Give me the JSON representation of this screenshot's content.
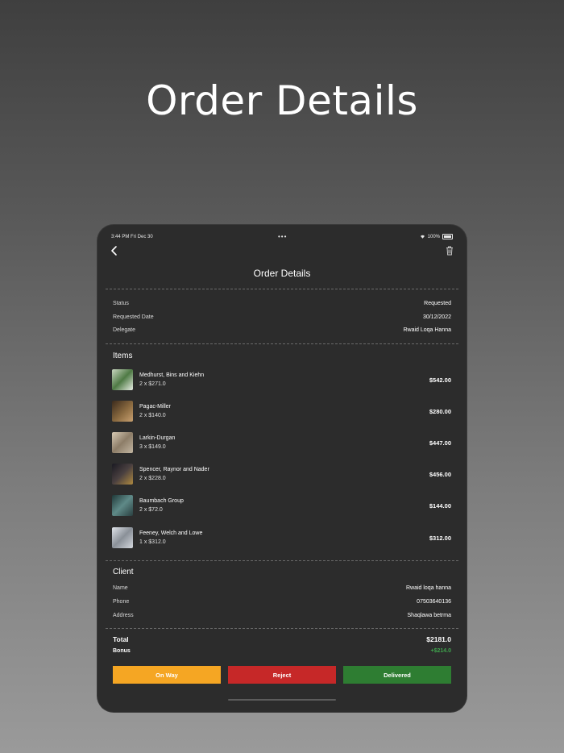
{
  "hero": {
    "title": "Order Details"
  },
  "status_bar": {
    "time": "3:44 PM  Fri Dec 30",
    "dots": "•••",
    "battery": "100%"
  },
  "header": {
    "title": "Order Details",
    "back_icon": "chevron-left-icon",
    "trash_icon": "trash-icon"
  },
  "details": [
    {
      "label": "Status",
      "value": "Requested"
    },
    {
      "label": "Requested Date",
      "value": "30/12/2022"
    },
    {
      "label": "Delegate",
      "value": "Rwaid Loqa Hanna"
    }
  ],
  "items_section": {
    "title": "Items",
    "items": [
      {
        "name": "Medhurst, Bins and Kiehn",
        "qty": "2  x  $271.0",
        "total": "$542.00",
        "thumb_color": "#6f8f5a"
      },
      {
        "name": "Pagac-Miller",
        "qty": "2  x  $140.0",
        "total": "$280.00",
        "thumb_color": "#7a5a3a"
      },
      {
        "name": "Larkin-Durgan",
        "qty": "3  x  $149.0",
        "total": "$447.00",
        "thumb_color": "#a89880"
      },
      {
        "name": "Spencer, Raynor and Nader",
        "qty": "2  x  $228.0",
        "total": "$456.00",
        "thumb_color": "#2a2a2e"
      },
      {
        "name": "Baumbach Group",
        "qty": "2  x  $72.0",
        "total": "$144.00",
        "thumb_color": "#2f4a4a"
      },
      {
        "name": "Feeney, Welch and Lowe",
        "qty": "1  x  $312.0",
        "total": "$312.00",
        "thumb_color": "#9aa0a8"
      }
    ]
  },
  "client": {
    "title": "Client",
    "rows": [
      {
        "label": "Name",
        "value": "Rwaid loqa hanna"
      },
      {
        "label": "Phone",
        "value": "07503640136"
      },
      {
        "label": "Address",
        "value": "Shaqlawa betrma"
      }
    ]
  },
  "summary": {
    "total_label": "Total",
    "total_value": "$2181.0",
    "bonus_label": "Bonus",
    "bonus_value": "+$214.0"
  },
  "actions": {
    "on_way": "On Way",
    "reject": "Reject",
    "delivered": "Delivered",
    "on_way_color": "#f5a623",
    "reject_color": "#c62828",
    "delivered_color": "#2e7d32"
  }
}
